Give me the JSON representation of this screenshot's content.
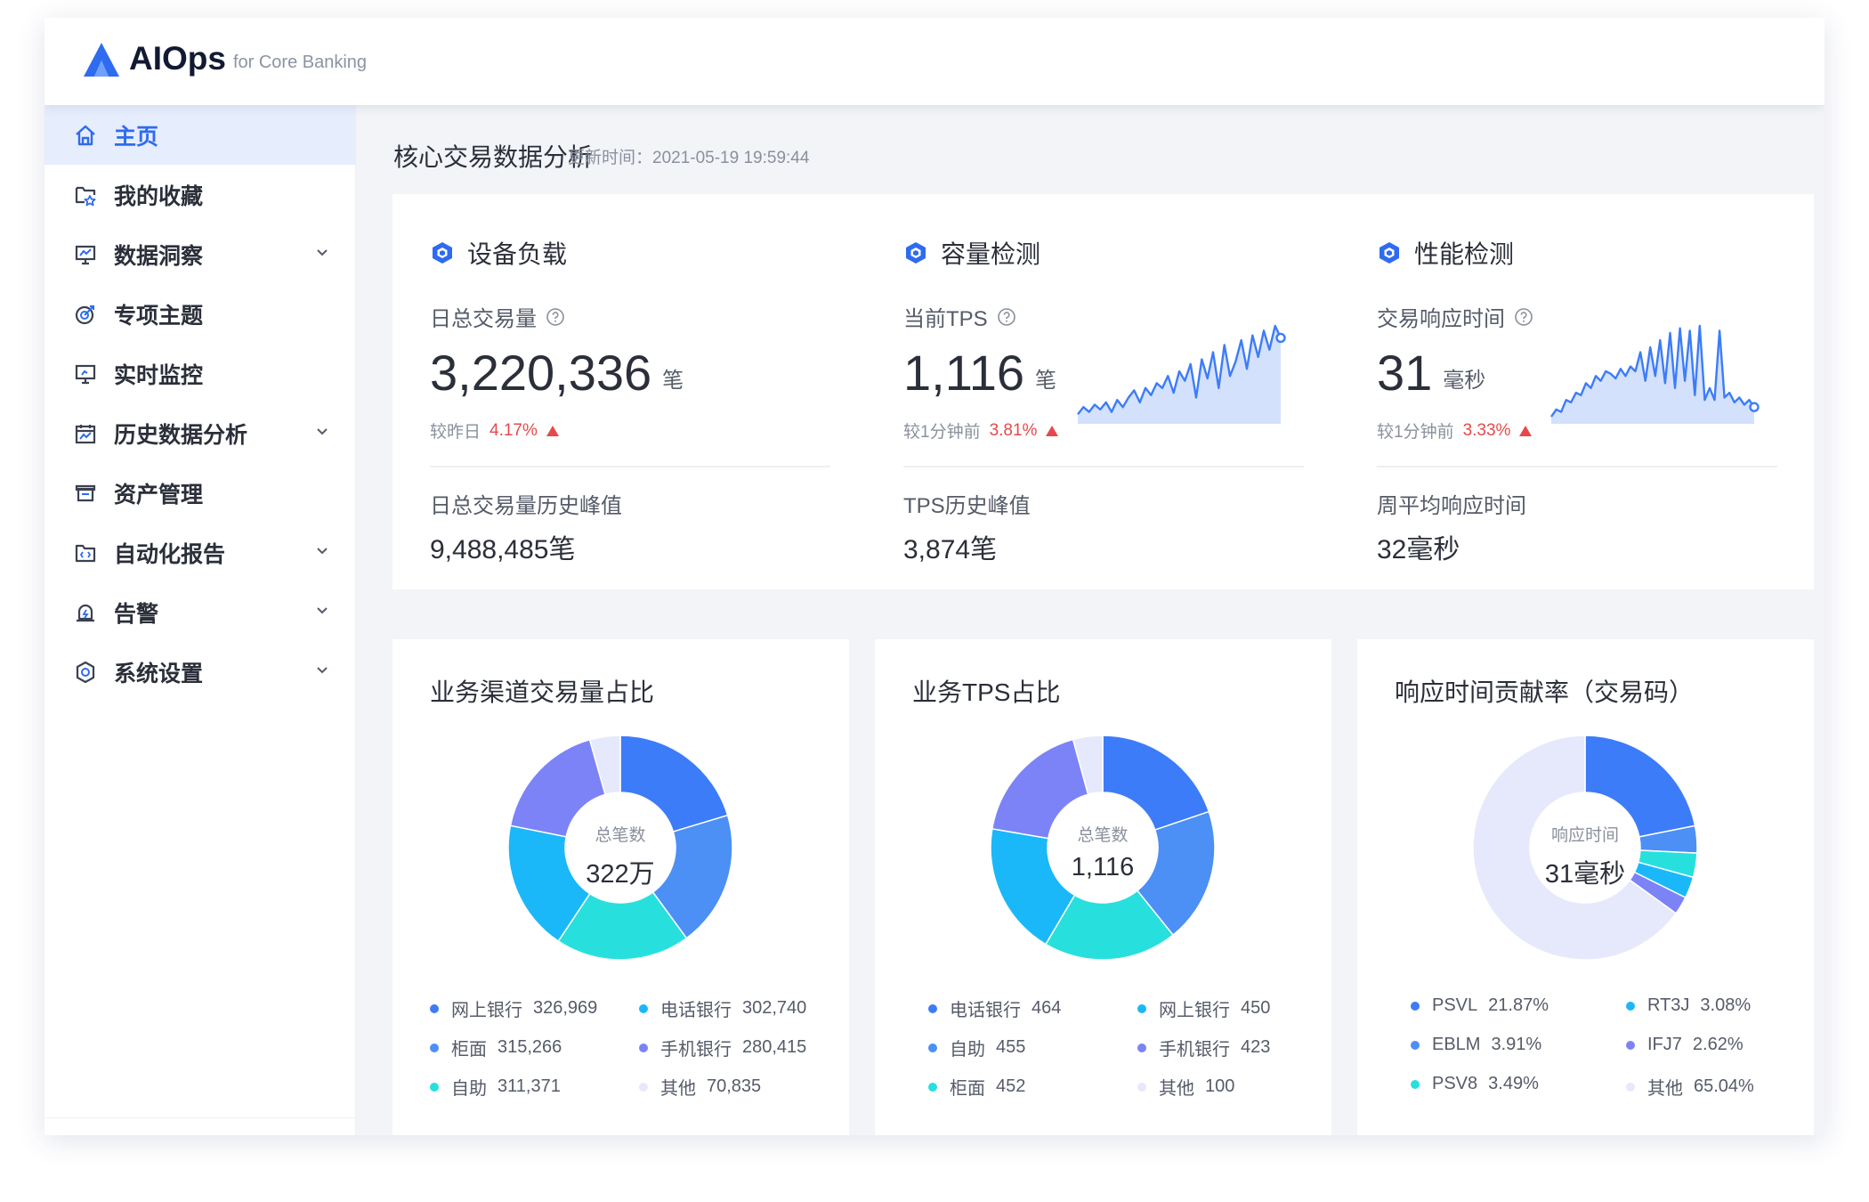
{
  "app": {
    "logo_name": "AIOps",
    "logo_sub": "for Core Banking",
    "brand_color": "#2f6bf0"
  },
  "sidebar": {
    "items": [
      {
        "label": "主页",
        "icon": "home-icon",
        "active": true,
        "expandable": false
      },
      {
        "label": "我的收藏",
        "icon": "favorite-folder-icon",
        "active": false,
        "expandable": false
      },
      {
        "label": "数据洞察",
        "icon": "monitor-chart-icon",
        "active": false,
        "expandable": true
      },
      {
        "label": "专项主题",
        "icon": "target-icon",
        "active": false,
        "expandable": false
      },
      {
        "label": "实时监控",
        "icon": "monitor-icon",
        "active": false,
        "expandable": false
      },
      {
        "label": "历史数据分析",
        "icon": "calendar-chart-icon",
        "active": false,
        "expandable": true
      },
      {
        "label": "资产管理",
        "icon": "box-icon",
        "active": false,
        "expandable": false
      },
      {
        "label": "自动化报告",
        "icon": "code-folder-icon",
        "active": false,
        "expandable": true
      },
      {
        "label": "告警",
        "icon": "alarm-icon",
        "active": false,
        "expandable": true
      },
      {
        "label": "系统设置",
        "icon": "gear-icon",
        "active": false,
        "expandable": true
      }
    ]
  },
  "header": {
    "title": "核心交易数据分析",
    "update_time": "更新时间：2021-05-19 19:59:44"
  },
  "metrics": [
    {
      "section": "设备负载",
      "label": "日总交易量",
      "value": "3,220,336",
      "unit": "笔",
      "compare_label": "较昨日",
      "compare_pct": "4.17%",
      "peak_label": "日总交易量历史峰值",
      "peak_value": "9,488,485笔"
    },
    {
      "section": "容量检测",
      "label": "当前TPS",
      "value": "1,116",
      "unit": "笔",
      "compare_label": "较1分钟前",
      "compare_pct": "3.81%",
      "peak_label": "TPS历史峰值",
      "peak_value": "3,874笔",
      "sparkline": [
        8,
        14,
        10,
        16,
        12,
        18,
        10,
        20,
        14,
        22,
        28,
        18,
        30,
        24,
        34,
        30,
        40,
        26,
        44,
        36,
        50,
        22,
        54,
        38,
        60,
        30,
        66,
        40,
        52,
        70,
        46,
        74,
        56,
        78,
        62,
        82,
        72
      ]
    },
    {
      "section": "性能检测",
      "label": "交易响应时间",
      "value": "31",
      "unit": "毫秒",
      "compare_label": "较1分钟前",
      "compare_pct": "3.33%",
      "peak_label": "周平均响应时间",
      "peak_value": "32毫秒",
      "sparkline": [
        6,
        12,
        10,
        20,
        18,
        26,
        24,
        34,
        30,
        40,
        36,
        44,
        42,
        38,
        46,
        40,
        48,
        44,
        60,
        36,
        64,
        40,
        70,
        34,
        76,
        30,
        80,
        36,
        78,
        24,
        82,
        20,
        30,
        20,
        78,
        22,
        26,
        18,
        22,
        16,
        20,
        14
      ]
    }
  ],
  "charts": [
    {
      "title": "业务渠道交易量占比",
      "center_label": "总笔数",
      "center_value": "322万",
      "legend": [
        {
          "name": "网上银行",
          "value": "326,969"
        },
        {
          "name": "电话银行",
          "value": "302,740"
        },
        {
          "name": "柜面",
          "value": "315,266"
        },
        {
          "name": "手机银行",
          "value": "280,415"
        },
        {
          "name": "自助",
          "value": "311,371"
        },
        {
          "name": "其他",
          "value": "70,835"
        }
      ]
    },
    {
      "title": "业务TPS占比",
      "center_label": "总笔数",
      "center_value": "1,116",
      "legend": [
        {
          "name": "电话银行",
          "value": "464"
        },
        {
          "name": "网上银行",
          "value": "450"
        },
        {
          "name": "自助",
          "value": "455"
        },
        {
          "name": "手机银行",
          "value": "423"
        },
        {
          "name": "柜面",
          "value": "452"
        },
        {
          "name": "其他",
          "value": "100"
        }
      ]
    },
    {
      "title": "响应时间贡献率（交易码）",
      "center_label": "响应时间",
      "center_value": "31毫秒",
      "legend": [
        {
          "name": "PSVL",
          "value": "21.87%"
        },
        {
          "name": "RT3J",
          "value": "3.08%"
        },
        {
          "name": "EBLM",
          "value": "3.91%"
        },
        {
          "name": "IFJ7",
          "value": "2.62%"
        },
        {
          "name": "PSV8",
          "value": "3.49%"
        },
        {
          "name": "其他",
          "value": "65.04%"
        }
      ]
    }
  ],
  "chart_data": [
    {
      "type": "pie",
      "title": "业务渠道交易量占比",
      "categories": [
        "网上银行",
        "柜面",
        "自助",
        "电话银行",
        "手机银行",
        "其他"
      ],
      "values": [
        326969,
        315266,
        311371,
        302740,
        280415,
        70835
      ],
      "colors": [
        "#3d7cf8",
        "#4c8ff5",
        "#27e0dd",
        "#1ab8f8",
        "#7b83f7",
        "#e6e9fb"
      ]
    },
    {
      "type": "pie",
      "title": "业务TPS占比",
      "categories": [
        "电话银行",
        "自助",
        "柜面",
        "网上银行",
        "手机银行",
        "其他"
      ],
      "values": [
        464,
        455,
        452,
        450,
        423,
        100
      ],
      "colors": [
        "#3d7cf8",
        "#4c8ff5",
        "#27e0dd",
        "#1ab8f8",
        "#7b83f7",
        "#e6e9fb"
      ]
    },
    {
      "type": "pie",
      "title": "响应时间贡献率（交易码）",
      "categories": [
        "PSVL",
        "EBLM",
        "PSV8",
        "RT3J",
        "IFJ7",
        "其他"
      ],
      "values": [
        21.87,
        3.91,
        3.49,
        3.08,
        2.62,
        65.04
      ],
      "colors": [
        "#3d7cf8",
        "#4c8ff5",
        "#27e0dd",
        "#1ab8f8",
        "#7b83f7",
        "#e6e9fb"
      ]
    }
  ],
  "legend_colors": [
    "#3d7cf8",
    "#1ab8f8",
    "#4c8ff5",
    "#7b83f7",
    "#27e0dd",
    "#e6e9fb"
  ],
  "alert_color": "#e6494b",
  "accent_color": "#2f6bf0"
}
